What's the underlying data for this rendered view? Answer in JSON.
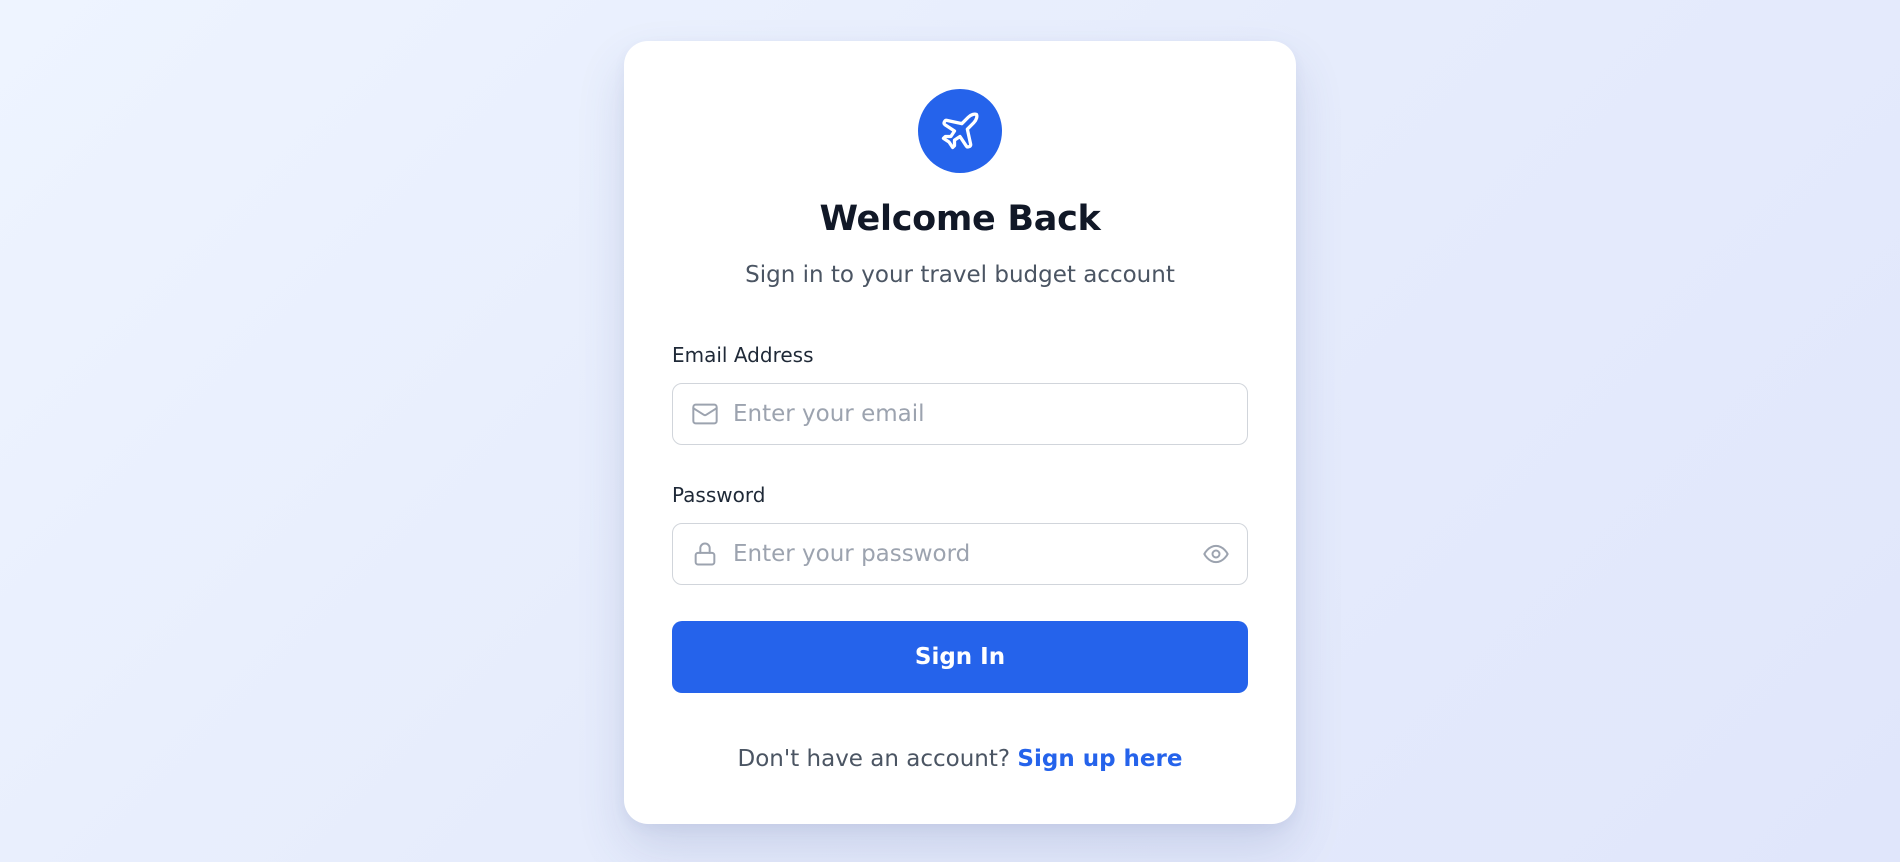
{
  "login": {
    "logo_icon": "airplane-icon",
    "title": "Welcome Back",
    "subtitle": "Sign in to your travel budget account",
    "email": {
      "label": "Email Address",
      "placeholder": "Enter your email",
      "value": "",
      "icon": "mail-icon"
    },
    "password": {
      "label": "Password",
      "placeholder": "Enter your password",
      "value": "",
      "icon": "lock-icon",
      "toggle_icon": "eye-icon"
    },
    "submit_label": "Sign In",
    "footer": {
      "prompt": "Don't have an account? ",
      "link_label": "Sign up here"
    }
  },
  "colors": {
    "accent": "#2563eb",
    "heading": "#111827",
    "muted_text": "#4b5563",
    "placeholder": "#9ca3af",
    "border": "#d1d5db"
  }
}
